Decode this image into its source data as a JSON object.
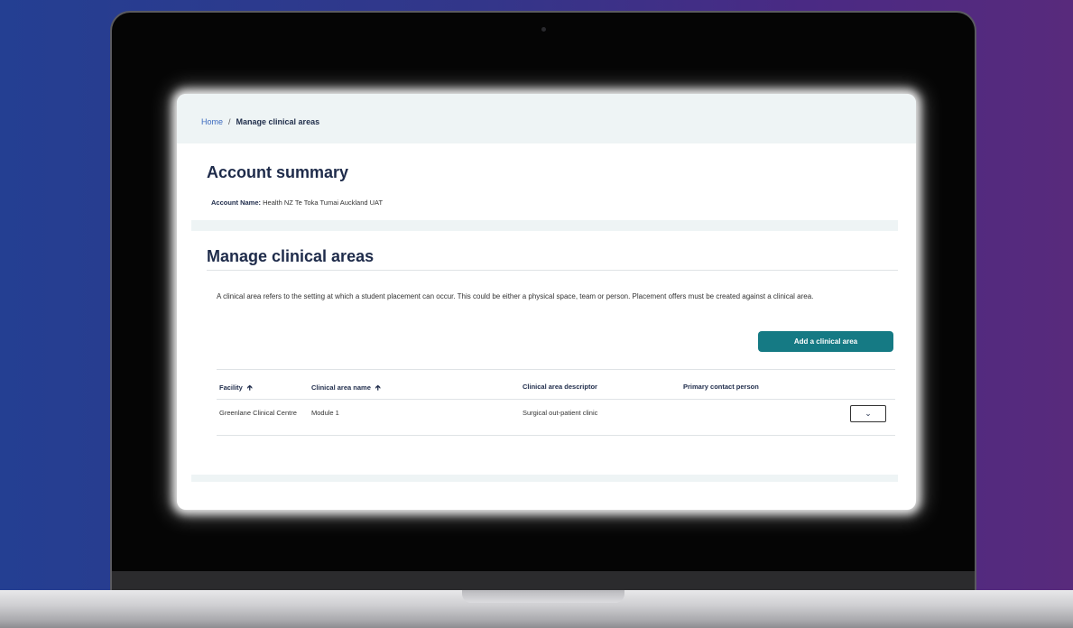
{
  "breadcrumb": {
    "home": "Home",
    "separator": "/",
    "current": "Manage clinical areas"
  },
  "account_summary": {
    "title": "Account summary",
    "name_label": "Account Name:",
    "name_value": "Health NZ Te Toka Tumai Auckland UAT"
  },
  "manage": {
    "title": "Manage clinical areas",
    "description": "A clinical area refers to the setting at which a student placement can occur. This could be either a physical space, team or person. Placement offers must be created against a clinical area.",
    "add_button": "Add a clinical area",
    "columns": [
      "Facility",
      "Clinical area name",
      "Clinical area descriptor",
      "Primary contact person"
    ],
    "sort_icon": "arrow-up-icon",
    "rows": [
      {
        "facility": "Greenlane Clinical Centre",
        "name": "Module 1",
        "descriptor": "Surgical out-patient clinic",
        "contact": ""
      }
    ]
  },
  "icons": {
    "expand": "chevron-down-icon"
  },
  "colors": {
    "accent": "#157a84",
    "heading": "#1e2b4a",
    "link": "#3d6bbf"
  }
}
